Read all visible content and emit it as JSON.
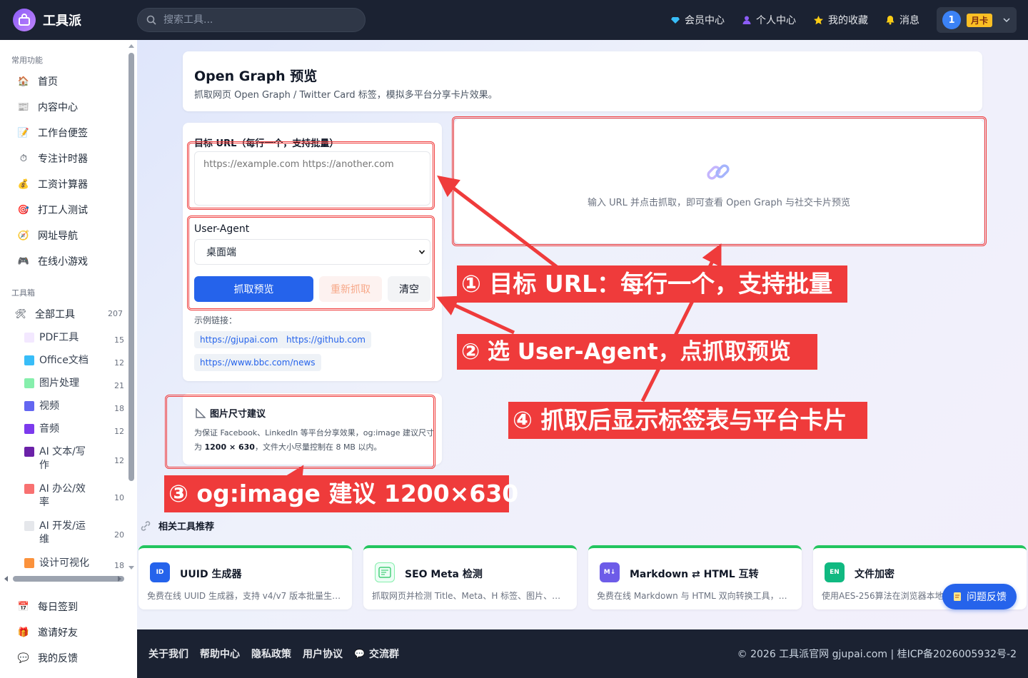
{
  "app": {
    "name": "工具派"
  },
  "search": {
    "placeholder": "搜索工具..."
  },
  "topnav": {
    "vip": "会员中心",
    "profile": "个人中心",
    "favorites": "我的收藏",
    "messages": "消息"
  },
  "user": {
    "avatar_text": "1",
    "plan": "月卡"
  },
  "sidebar": {
    "common_title": "常用功能",
    "common_items": [
      "首页",
      "内容中心",
      "工作台便签",
      "专注计时器",
      "工资计算器",
      "打工人测试",
      "网址导航",
      "在线小游戏"
    ],
    "toolbox_title": "工具箱",
    "all_tools": {
      "label": "全部工具",
      "count": "207"
    },
    "categories": [
      {
        "label": "PDF工具",
        "count": "15"
      },
      {
        "label": "Office文档",
        "count": "12"
      },
      {
        "label": "图片处理",
        "count": "21"
      },
      {
        "label": "视频",
        "count": "18"
      },
      {
        "label": "音频",
        "count": "12"
      },
      {
        "label": "AI 文本/写作",
        "count": "12"
      },
      {
        "label": "AI 办公/效率",
        "count": "10"
      },
      {
        "label": "AI 开发/运维",
        "count": "20"
      },
      {
        "label": "设计可视化",
        "count": "18"
      }
    ],
    "bottom_items": [
      "每日签到",
      "邀请好友",
      "我的反馈"
    ]
  },
  "page": {
    "title": "Open Graph 预览",
    "subtitle": "抓取网页 Open Graph / Twitter Card 标签，模拟多平台分享卡片效果。"
  },
  "form": {
    "url_label": "目标 URL（每行一个，支持批量）",
    "url_placeholder": "https://example.com https://another.com",
    "ua_label": "User-Agent",
    "ua_selected": "桌面端",
    "fetch_button": "抓取预览",
    "refetch_button": "重新抓取",
    "clear_button": "清空",
    "examples_label": "示例链接：",
    "examples": [
      "https://gjupai.com",
      "https://github.com",
      "https://www.bbc.com/news"
    ]
  },
  "preview": {
    "empty_text": "输入 URL 并点击抓取，即可查看 Open Graph 与社交卡片预览"
  },
  "tip": {
    "title": "图片尺寸建议",
    "text": "为保证 Facebook、LinkedIn 等平台分享效果，og:image 建议尺寸为 ",
    "size": "1200 × 630",
    "text2": "，文件大小尽量控制在 8 MB 以内。"
  },
  "annotations": [
    "① 目标 URL：每行一个，支持批量",
    "② 选 User-Agent，点抓取预览",
    "③ og:image 建议 1200×630",
    "④ 抓取后显示标签表与平台卡片"
  ],
  "related": {
    "title": "相关工具推荐",
    "tools": [
      {
        "icon": "ID",
        "name": "UUID 生成器",
        "desc": "免费在线 UUID 生成器，支持 v4/v7 版本批量生成..."
      },
      {
        "icon": "seo",
        "name": "SEO Meta 检测",
        "desc": "抓取网页并检测 Title、Meta、H 标签、图片、链..."
      },
      {
        "icon": "M↓",
        "name": "Markdown ⇄ HTML 互转",
        "desc": "免费在线 Markdown 与 HTML 双向转换工具，支..."
      },
      {
        "icon": "EN",
        "name": "文件加密",
        "desc": "使用AES-256算法在浏览器本地加密..."
      }
    ]
  },
  "feedback": {
    "label": "问题反馈"
  },
  "footer": {
    "links": [
      "关于我们",
      "帮助中心",
      "隐私政策",
      "用户协议",
      "交流群"
    ],
    "copyright": "© 2026 工具派官网 gjupai.com | 桂ICP备2026005932号-2"
  },
  "colors": {
    "primary": "#2563eb",
    "annotation_red": "#ef3b3b",
    "topbar": "#1b2232",
    "related_accent": "#22c55e"
  }
}
